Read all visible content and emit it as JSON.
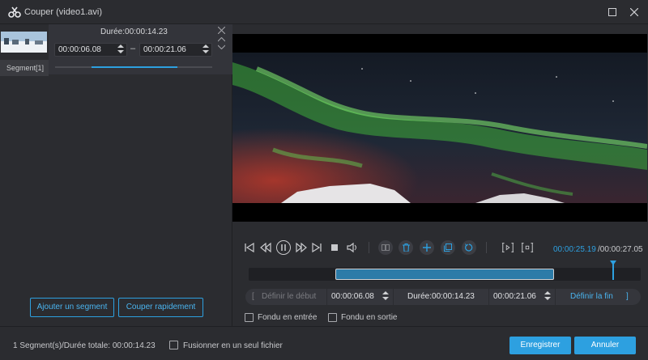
{
  "window": {
    "title": "Couper (video1.avi)",
    "maximize_icon": "square-icon",
    "close_icon": "close-icon"
  },
  "segment": {
    "label": "Segment[1]",
    "duration_label": "Durée:00:00:14.23",
    "start_time": "00:00:06.08",
    "end_time": "00:00:21.06",
    "dash": "–",
    "progress_start": 0.23,
    "progress_end": 0.78
  },
  "left_buttons": {
    "add_segment": "Ajouter un segment",
    "quick_split": "Couper rapidement"
  },
  "player": {
    "current_time": "00:00:25.19",
    "total_time": "/00:00:27.05",
    "playhead_fraction": 0.93
  },
  "trim": {
    "set_start": "Définir le début",
    "start_value": "00:00:06.08",
    "duration": "Durée:00:00:14.23",
    "end_value": "00:00:21.06",
    "set_end": "Définir la fin",
    "bracket_left": "[",
    "bracket_right": "]"
  },
  "options": {
    "fade_in": "Fondu en entrée",
    "fade_out": "Fondu en sortie",
    "merge": "Fusionner en un seul fichier"
  },
  "footer": {
    "info": "1 Segment(s)/Durée totale: 00:00:14.23",
    "save": "Enregistrer",
    "cancel": "Annuler"
  },
  "colors": {
    "accent": "#2da0e0",
    "background": "#2b2c30"
  }
}
